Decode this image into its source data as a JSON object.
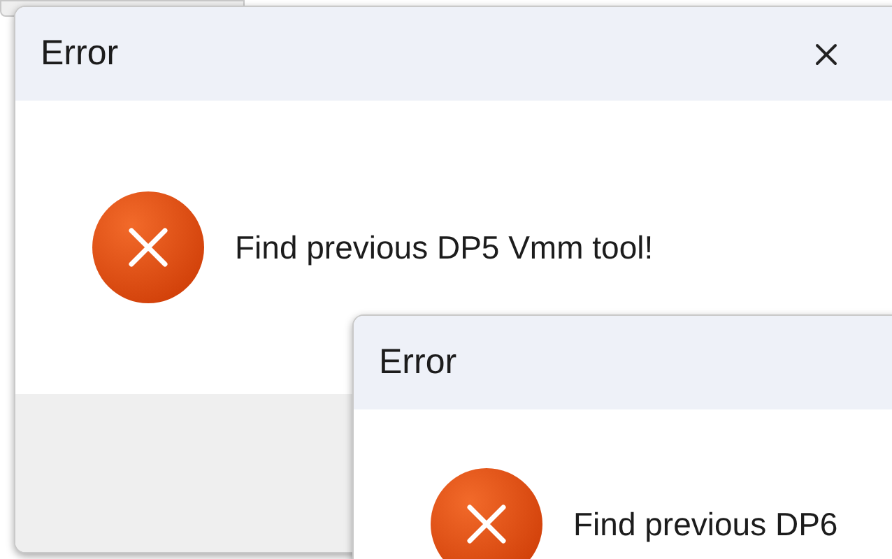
{
  "dialogs": [
    {
      "title": "Error",
      "message": "Find previous DP5 Vmm tool!",
      "close_shown": true
    },
    {
      "title": "Error",
      "message": "Find previous DP6",
      "close_shown": false
    }
  ]
}
